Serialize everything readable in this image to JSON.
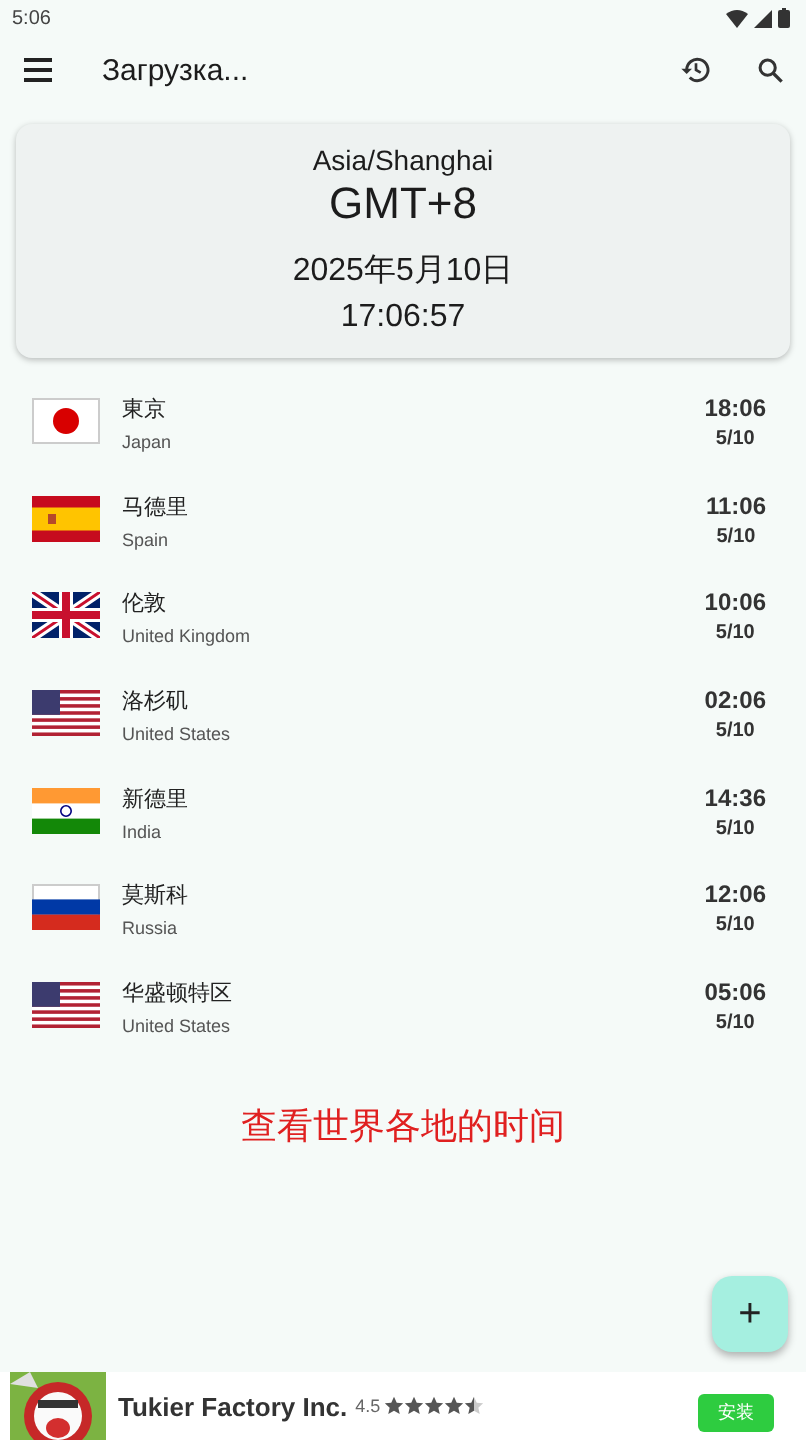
{
  "status_bar": {
    "time": "5:06"
  },
  "app_bar": {
    "title": "Загрузка..."
  },
  "current": {
    "zone": "Asia/Shanghai",
    "offset": "GMT+8",
    "date": "2025年5月10日",
    "time": "17:06:57"
  },
  "cities": [
    {
      "kind": "jp",
      "city": "東京",
      "country": "Japan",
      "time": "18:06",
      "date": "5/10"
    },
    {
      "kind": "es",
      "city": "马德里",
      "country": "Spain",
      "time": "11:06",
      "date": "5/10"
    },
    {
      "kind": "gb",
      "city": "伦敦",
      "country": "United Kingdom",
      "time": "10:06",
      "date": "5/10"
    },
    {
      "kind": "us",
      "city": "洛杉矶",
      "country": "United States",
      "time": "02:06",
      "date": "5/10"
    },
    {
      "kind": "in",
      "city": "新德里",
      "country": "India",
      "time": "14:36",
      "date": "5/10"
    },
    {
      "kind": "ru",
      "city": "莫斯科",
      "country": "Russia",
      "time": "12:06",
      "date": "5/10"
    },
    {
      "kind": "us",
      "city": "华盛顿特区",
      "country": "United States",
      "time": "05:06",
      "date": "5/10"
    }
  ],
  "caption": "查看世界各地的时间",
  "fab": {
    "label": "+"
  },
  "ad": {
    "kind": "picture",
    "title": "Tukier Factory Inc.",
    "rating": "4.5",
    "stars": 4.5,
    "button": "安装"
  }
}
